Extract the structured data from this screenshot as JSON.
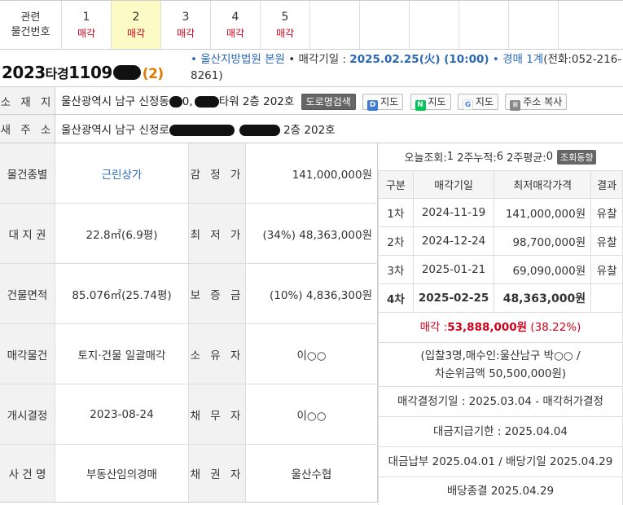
{
  "related": {
    "label_line1": "관련",
    "label_line2": "물건번호",
    "items": [
      {
        "num": "1",
        "status": "매각"
      },
      {
        "num": "2",
        "status": "매각"
      },
      {
        "num": "3",
        "status": "매각"
      },
      {
        "num": "4",
        "status": "매각"
      },
      {
        "num": "5",
        "status": "매각"
      }
    ]
  },
  "case": {
    "year": "2023",
    "type": "타경",
    "number": "1109",
    "sub": "(2)",
    "court_bullet": "•",
    "court": "울산지방법원 본원",
    "date_label": "• 매각기일 : ",
    "date": "2025.02.25(火) (10:00)",
    "dept_bullet": "•",
    "dept": "경매 1계",
    "phone": "(전화:052-216-8261)"
  },
  "address": {
    "location_label": "소 재 지",
    "location_a": "울산광역시 남구 신정동",
    "location_b": "0,",
    "location_c": "타워 2층 202호",
    "road_search_btn": "도로명검색",
    "daum_map_btn": "지도",
    "naver_map_btn": "지도",
    "google_map_btn": "지도",
    "copy_btn": "주소 복사",
    "new_label": "새 주 소",
    "new_a": "울산광역시 남구 신정로",
    "new_b": "2층 202호"
  },
  "details": [
    {
      "label1": "물건종별",
      "value1": "근린상가",
      "label2": "감 정 가",
      "value2": "141,000,000원"
    },
    {
      "label1": "대 지 권",
      "value1": "22.8㎡(6.9평)",
      "label2": "최 저 가",
      "value2": "(34%) 48,363,000원"
    },
    {
      "label1": "건물면적",
      "value1": "85.076㎡(25.74평)",
      "label2": "보 증 금",
      "value2": "(10%) 4,836,300원"
    },
    {
      "label1": "매각물건",
      "value1": "토지·건물 일괄매각",
      "label2": "소 유 자",
      "value2": "이○○"
    },
    {
      "label1": "개시결정",
      "value1": "2023-08-24",
      "label2": "채 무 자",
      "value2": "이○○"
    },
    {
      "label1": "사 건 명",
      "value1": "부동산임의경매",
      "label2": "채 권 자",
      "value2": "울산수협"
    }
  ],
  "stats": {
    "today_label": "오늘조회: ",
    "today": "1",
    "acc_label": " 2주누적: ",
    "acc": "6",
    "avg_label": " 2주평균: ",
    "avg": "0",
    "trend_btn": "조회동향"
  },
  "history": {
    "headers": [
      "구분",
      "매각기일",
      "최저매각가격",
      "결과"
    ],
    "rows": [
      {
        "round": "1차",
        "date": "2024-11-19",
        "price": "141,000,000원",
        "result": "유찰"
      },
      {
        "round": "2차",
        "date": "2024-12-24",
        "price": "98,700,000원",
        "result": "유찰"
      },
      {
        "round": "3차",
        "date": "2025-01-21",
        "price": "69,090,000원",
        "result": "유찰"
      },
      {
        "round": "4차",
        "date": "2025-02-25",
        "price": "48,363,000원",
        "result": ""
      }
    ]
  },
  "sale": {
    "label": "매각 : ",
    "amount": "53,888,000원",
    "ratio": "(38.22%)",
    "bid_info_1": "(입찰3명,매수인:울산남구 박○○ /",
    "bid_info_2": "차순위금액 50,500,000원)",
    "decision": "매각결정기일 : 2025.03.04 - 매각허가결정",
    "payment_deadline": "대금지급기한 : 2025.04.04",
    "payment_done": "대금납부 2025.04.01 / 배당기일 2025.04.29",
    "dividend_end": "배당종결 2025.04.29"
  },
  "colors": {
    "sale_red": "#d0021b",
    "link_blue": "#2a68b8",
    "active_tab": "#fdfbc5",
    "sub_orange": "#e07b00"
  }
}
